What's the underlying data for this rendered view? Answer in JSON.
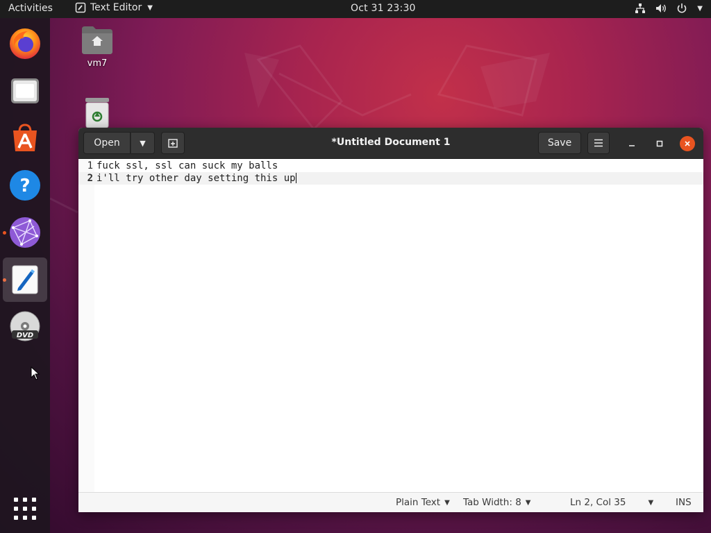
{
  "topbar": {
    "activities": "Activities",
    "app_name": "Text Editor",
    "clock": "Oct 31  23:30"
  },
  "desktop": {
    "home_folder_label": "vm7"
  },
  "window": {
    "title": "*Untitled Document 1",
    "open_label": "Open",
    "save_label": "Save"
  },
  "editor": {
    "lines": [
      {
        "number": "1",
        "text": "fuck ssl, ssl can suck my balls"
      },
      {
        "number": "2",
        "text": "i'll try other day setting this up"
      }
    ]
  },
  "statusbar": {
    "language": "Plain Text",
    "tab_width": "Tab Width: 8",
    "position": "Ln 2, Col 35",
    "mode": "INS"
  },
  "colors": {
    "accent": "#e95420",
    "topbar_bg": "#1d1d1d",
    "headerbar_bg": "#2d2d2d"
  },
  "icons": {
    "dock": [
      "firefox-icon",
      "files-icon",
      "software-icon",
      "help-icon",
      "network-app-icon",
      "text-editor-icon",
      "dvd-icon",
      "show-apps-icon"
    ],
    "tray": [
      "network-icon",
      "volume-icon",
      "power-icon"
    ]
  }
}
